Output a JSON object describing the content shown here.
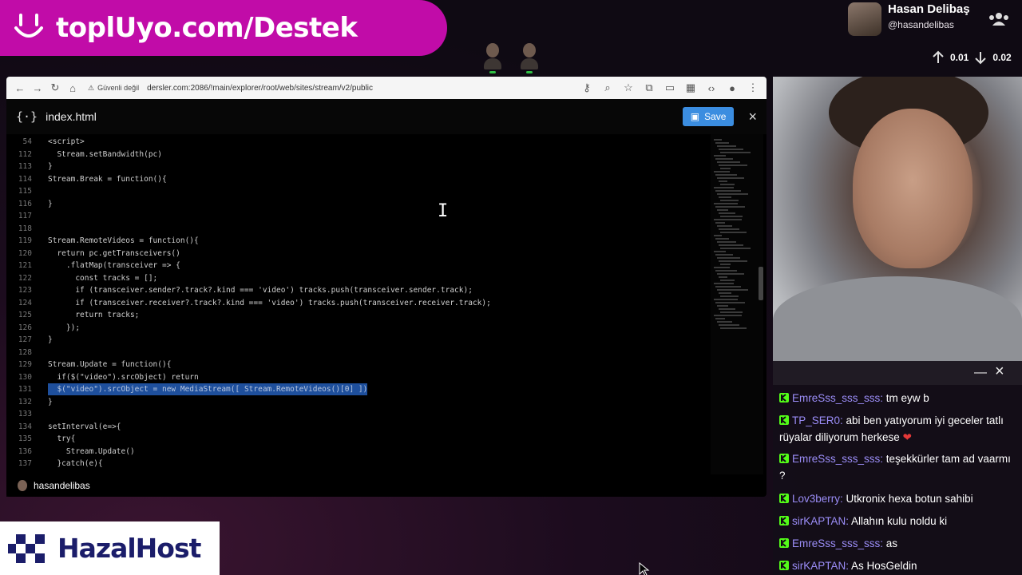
{
  "banner": {
    "text": "toplUyo.com/Destek",
    "color": "#c10ca8"
  },
  "streamer": {
    "name": "Hasan Delibaş",
    "handle": "@hasandelibas"
  },
  "network": {
    "up": "0.01",
    "down": "0.02"
  },
  "browser": {
    "security_label": "Güvenli değil",
    "url": "dersler.com:2086/!main/explorer/root/web/sites/stream/v2/public"
  },
  "editor": {
    "file_name": "index.html",
    "save_label": "Save",
    "close_label": "×"
  },
  "code_lines": [
    {
      "n": "54",
      "text": "<script>"
    },
    {
      "n": "112",
      "text": "  Stream.setBandwidth(pc)"
    },
    {
      "n": "113",
      "text": "}"
    },
    {
      "n": "114",
      "text": "Stream.Break = function(){"
    },
    {
      "n": "115",
      "text": ""
    },
    {
      "n": "116",
      "text": "}"
    },
    {
      "n": "117",
      "text": ""
    },
    {
      "n": "118",
      "text": ""
    },
    {
      "n": "119",
      "text": "Stream.RemoteVideos = function(){"
    },
    {
      "n": "120",
      "text": "  return pc.getTransceivers()"
    },
    {
      "n": "121",
      "text": "    .flatMap(transceiver => {"
    },
    {
      "n": "122",
      "text": "      const tracks = [];"
    },
    {
      "n": "123",
      "text": "      if (transceiver.sender?.track?.kind === 'video') tracks.push(transceiver.sender.track);"
    },
    {
      "n": "124",
      "text": "      if (transceiver.receiver?.track?.kind === 'video') tracks.push(transceiver.receiver.track);"
    },
    {
      "n": "125",
      "text": "      return tracks;"
    },
    {
      "n": "126",
      "text": "    });"
    },
    {
      "n": "127",
      "text": "}"
    },
    {
      "n": "128",
      "text": ""
    },
    {
      "n": "129",
      "text": "Stream.Update = function(){"
    },
    {
      "n": "130",
      "text": "  if($(\"video\").srcObject) return"
    },
    {
      "n": "131",
      "text": "  $(\"video\").srcObject = new MediaStream([ Stream.RemoteVideos()[0] ])",
      "highlight": true
    },
    {
      "n": "132",
      "text": "}"
    },
    {
      "n": "133",
      "text": ""
    },
    {
      "n": "134",
      "text": "setInterval(e=>{"
    },
    {
      "n": "135",
      "text": "  try{"
    },
    {
      "n": "136",
      "text": "    Stream.Update()"
    },
    {
      "n": "137",
      "text": "  }catch(e){"
    }
  ],
  "screen_user": "hasandelibas",
  "chat": {
    "messages": [
      {
        "user": "EmreSss_sss_sss:",
        "text": " tm eyw b"
      },
      {
        "user": "TP_SER0:",
        "text": " abi ben yatıyorum iyi geceler tatlı rüyalar diliyorum herkese ",
        "heart": "❤"
      },
      {
        "user": "EmreSss_sss_sss:",
        "text": " teşekkürler tam ad vaarmı ?"
      },
      {
        "user": "Lov3berry:",
        "text": " Utkronix hexa botun sahibi"
      },
      {
        "user": "sirKAPTAN:",
        "text": " Allahın kulu noldu ki"
      },
      {
        "user": "EmreSss_sss_sss:",
        "text": " as"
      },
      {
        "user": "sirKAPTAN:",
        "text": " As HosGeldin"
      }
    ]
  },
  "sponsor": {
    "text": "HazalHost",
    "color": "#1b1d6a"
  }
}
